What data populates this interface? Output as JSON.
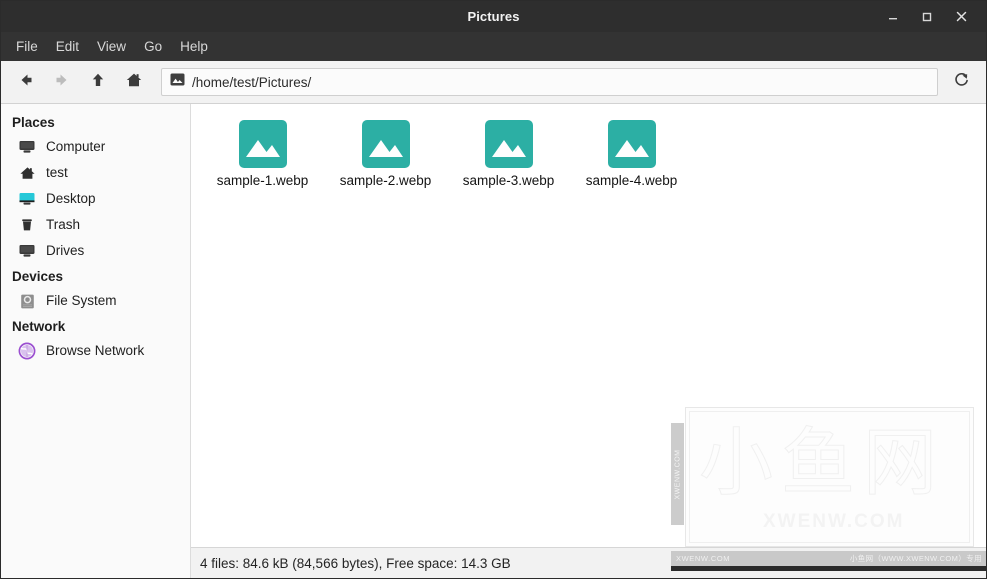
{
  "window": {
    "title": "Pictures",
    "controls": {
      "minimize": "minimize-icon",
      "maximize": "maximize-icon",
      "close": "close-icon"
    }
  },
  "menubar": {
    "items": [
      {
        "label": "File"
      },
      {
        "label": "Edit"
      },
      {
        "label": "View"
      },
      {
        "label": "Go"
      },
      {
        "label": "Help"
      }
    ]
  },
  "toolbar": {
    "back": "back-arrow-icon",
    "forward": "forward-arrow-icon",
    "up": "up-arrow-icon",
    "home": "home-icon",
    "reload": "reload-icon",
    "path": "/home/test/Pictures/",
    "path_icon": "image-folder-icon"
  },
  "sidebar": {
    "groups": [
      {
        "title": "Places",
        "items": [
          {
            "label": "Computer",
            "icon": "computer-icon"
          },
          {
            "label": "test",
            "icon": "home-icon"
          },
          {
            "label": "Desktop",
            "icon": "desktop-icon"
          },
          {
            "label": "Trash",
            "icon": "trash-icon"
          },
          {
            "label": "Drives",
            "icon": "drives-icon"
          }
        ]
      },
      {
        "title": "Devices",
        "items": [
          {
            "label": "File System",
            "icon": "harddisk-icon"
          }
        ]
      },
      {
        "title": "Network",
        "items": [
          {
            "label": "Browse Network",
            "icon": "network-globe-icon"
          }
        ]
      }
    ]
  },
  "files": {
    "items": [
      {
        "name": "sample-1.webp",
        "icon": "image-file-icon"
      },
      {
        "name": "sample-2.webp",
        "icon": "image-file-icon"
      },
      {
        "name": "sample-3.webp",
        "icon": "image-file-icon"
      },
      {
        "name": "sample-4.webp",
        "icon": "image-file-icon"
      }
    ]
  },
  "statusbar": {
    "text": "4 files: 84.6 kB (84,566 bytes), Free space: 14.3 GB"
  },
  "watermark": {
    "cjk": "小鱼网",
    "url": "XWENW.COM",
    "side_text": "XWENW.COM",
    "bottom_left": "XWENW.COM",
    "bottom_right": "小鱼网（WWW.XWENW.COM）专用"
  },
  "colors": {
    "titlebar_bg": "#2e2e2e",
    "menubar_bg": "#333333",
    "toolbar_bg": "#f2f2f2",
    "sidebar_bg": "#fafafa",
    "file_icon_teal": "#2CAFA4",
    "desktop_icon_cyan": "#25C8D8",
    "network_icon_purple": "#9B4FD0"
  }
}
